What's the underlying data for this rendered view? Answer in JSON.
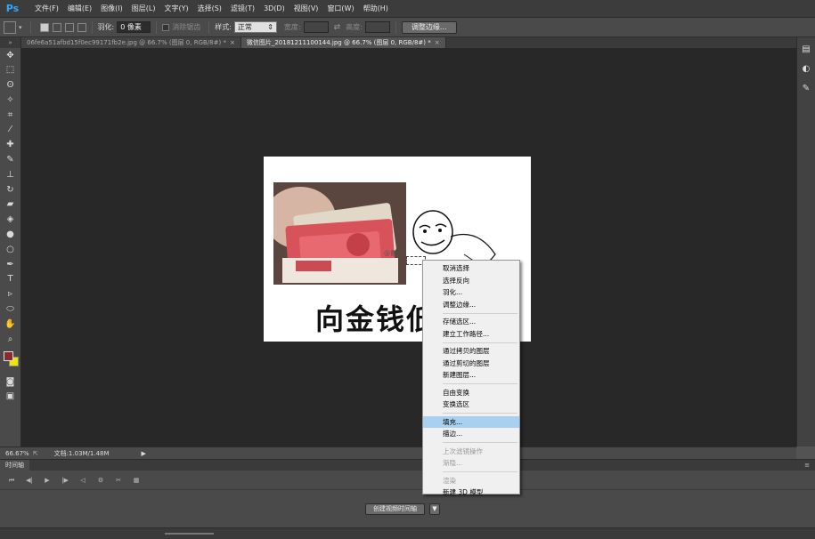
{
  "app": {
    "logo": "Ps"
  },
  "menu": [
    "文件(F)",
    "编辑(E)",
    "图像(I)",
    "图层(L)",
    "文字(Y)",
    "选择(S)",
    "滤镜(T)",
    "3D(D)",
    "视图(V)",
    "窗口(W)",
    "帮助(H)"
  ],
  "options": {
    "feather_label": "羽化:",
    "feather_value": "0 像素",
    "antialias_label": "消除锯齿",
    "style_label": "样式:",
    "style_value": "正常",
    "width_label": "宽度:",
    "height_label": "高度:",
    "refine_edge_button": "调整边缘..."
  },
  "tabs": [
    {
      "label": "06fe6a51afbd15f0ec99171fb2e.jpg @ 66.7% (图层 0, RGB/8#) *",
      "active": false
    },
    {
      "label": "微信图片_20181211100144.jpg @ 66.7% (图层 0, RGB/8#) *",
      "active": true
    }
  ],
  "tab_close": "×",
  "toolbar": {
    "header": "»",
    "tools": [
      {
        "name": "move-tool-icon",
        "glyph": "✥"
      },
      {
        "name": "marquee-tool-icon",
        "glyph": "⬚"
      },
      {
        "name": "lasso-tool-icon",
        "glyph": "ʘ"
      },
      {
        "name": "quick-select-tool-icon",
        "glyph": "✧"
      },
      {
        "name": "crop-tool-icon",
        "glyph": "⌗"
      },
      {
        "name": "eyedropper-tool-icon",
        "glyph": "⁄"
      },
      {
        "name": "healing-brush-tool-icon",
        "glyph": "✚"
      },
      {
        "name": "brush-tool-icon",
        "glyph": "✎"
      },
      {
        "name": "clone-stamp-tool-icon",
        "glyph": "⊥"
      },
      {
        "name": "history-brush-tool-icon",
        "glyph": "↻"
      },
      {
        "name": "eraser-tool-icon",
        "glyph": "▰"
      },
      {
        "name": "paint-bucket-tool-icon",
        "glyph": "◈"
      },
      {
        "name": "blur-tool-icon",
        "glyph": "●"
      },
      {
        "name": "dodge-tool-icon",
        "glyph": "○"
      },
      {
        "name": "pen-tool-icon",
        "glyph": "✒"
      },
      {
        "name": "type-tool-icon",
        "glyph": "T"
      },
      {
        "name": "path-select-tool-icon",
        "glyph": "▹"
      },
      {
        "name": "shape-tool-icon",
        "glyph": "⬭"
      },
      {
        "name": "hand-tool-icon",
        "glyph": "✋"
      },
      {
        "name": "zoom-tool-icon",
        "glyph": "⌕"
      }
    ],
    "foreground_color": "#8b2a2a",
    "background_color": "#e8e800",
    "extra": [
      {
        "name": "quick-mask-icon",
        "glyph": "◙"
      },
      {
        "name": "screen-mode-icon",
        "glyph": "▣"
      }
    ]
  },
  "right_panel": [
    {
      "name": "panel-history-icon",
      "glyph": "▤"
    },
    {
      "name": "panel-adjust-icon",
      "glyph": "◐"
    },
    {
      "name": "panel-brush-icon",
      "glyph": "✎"
    }
  ],
  "document": {
    "caption": "向金钱低",
    "watermark": "@曹..."
  },
  "status": {
    "zoom": "66.67%",
    "doc_info": "文档:1.03M/1.48M",
    "arrow": "▶"
  },
  "timeline": {
    "tab_label": "时间轴",
    "controls": [
      "⏮",
      "◀|",
      "▶",
      "|▶",
      "◁",
      "⚙",
      "✂",
      "▦"
    ],
    "create_button": "创建视频时间轴",
    "create_arrow": "▼"
  },
  "context_menu": {
    "groups": [
      [
        {
          "label": "取消选择"
        },
        {
          "label": "选择反向"
        },
        {
          "label": "羽化..."
        },
        {
          "label": "调整边缘..."
        }
      ],
      [
        {
          "label": "存储选区..."
        },
        {
          "label": "建立工作路径..."
        }
      ],
      [
        {
          "label": "通过拷贝的图层"
        },
        {
          "label": "通过剪切的图层"
        },
        {
          "label": "新建图层..."
        }
      ],
      [
        {
          "label": "自由变换"
        },
        {
          "label": "变换选区"
        }
      ],
      [
        {
          "label": "填充...",
          "highlighted": true
        },
        {
          "label": "描边..."
        }
      ],
      [
        {
          "label": "上次滤镜操作",
          "disabled": true
        },
        {
          "label": "渐隐...",
          "disabled": true
        }
      ],
      [
        {
          "label": "渲染",
          "disabled": true
        },
        {
          "label": "新建 3D 模型"
        }
      ]
    ]
  }
}
